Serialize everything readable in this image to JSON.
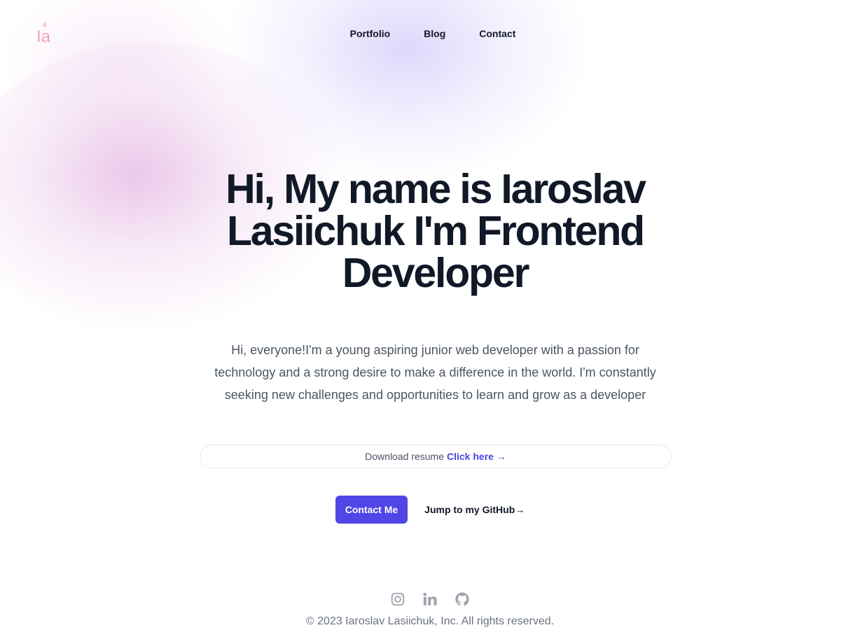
{
  "brand": {
    "logo_mark": "⚘",
    "logo_text": "Ia"
  },
  "nav": {
    "items": [
      {
        "label": "Portfolio"
      },
      {
        "label": "Blog"
      },
      {
        "label": "Contact"
      }
    ]
  },
  "hero": {
    "title": "Hi, My name is Iaroslav Lasiichuk I'm Frontend Developer",
    "description": "Hi, everyone!I'm a young aspiring junior web developer with a passion for technology and a strong desire to make a difference in the world. I'm constantly seeking new challenges and opportunities to learn and grow as a developer",
    "resume_text": "Download resume",
    "resume_link": "Click here →",
    "primary_button": "Contact Me",
    "secondary_link": "Jump to my GitHub→"
  },
  "footer": {
    "socials": [
      {
        "icon": "instagram-icon"
      },
      {
        "icon": "linkedin-icon"
      },
      {
        "icon": "github-icon"
      }
    ],
    "copyright": "© 2023 Iaroslav Lasiichuk, Inc. All rights reserved."
  },
  "colors": {
    "accent": "#4f46e5",
    "heading": "#111827",
    "body_text": "#4b5563",
    "muted": "#6b7280",
    "logo": "#f3a1bb"
  }
}
